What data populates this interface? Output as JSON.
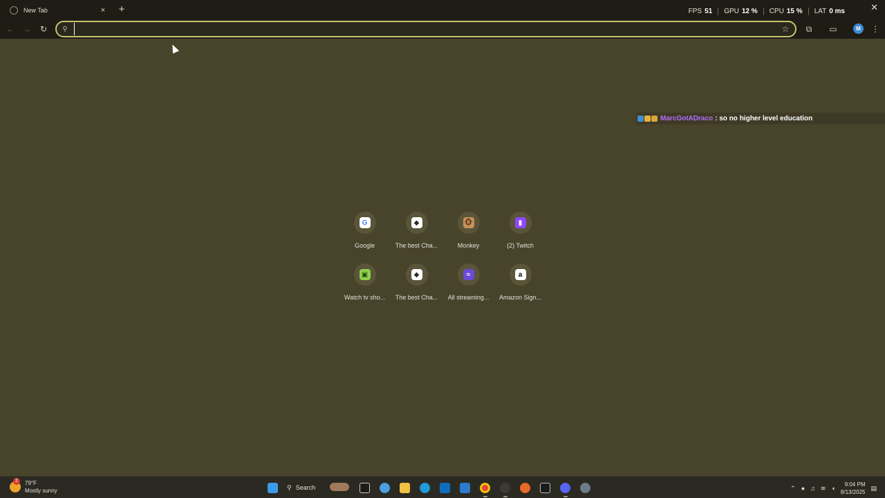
{
  "browser": {
    "tab_title": "New Tab",
    "tab_close": "×",
    "new_tab": "+",
    "window_close": "✕"
  },
  "overlay_stats": [
    {
      "label": "FPS",
      "value": "51"
    },
    {
      "label": "GPU",
      "value": "12 %"
    },
    {
      "label": "CPU",
      "value": "15 %"
    },
    {
      "label": "LAT",
      "value": "0 ms"
    }
  ],
  "toolbar": {
    "omnibox_value": "",
    "avatar_letter": "M"
  },
  "chat": {
    "username": "MarcGotADraco",
    "message": ": so no higher level education"
  },
  "shortcuts": [
    {
      "label": "Google",
      "icon": "google-icon",
      "glyph": "G",
      "color": "#ffffff",
      "text": "#4285f4"
    },
    {
      "label": "The best Cha...",
      "icon": "chess-icon",
      "glyph": "◆",
      "color": "#ffffff",
      "text": "#2b2a22"
    },
    {
      "label": "Monkey",
      "icon": "monkey-icon",
      "glyph": "🐵",
      "color": "#c8905a",
      "text": "#3a2612"
    },
    {
      "label": "(2) Twitch",
      "icon": "twitch-icon",
      "glyph": "▮",
      "color": "#9146ff",
      "text": "#ffffff"
    },
    {
      "label": "Watch tv sho...",
      "icon": "tv-icon",
      "glyph": "▣",
      "color": "#8fd14a",
      "text": "#2a4a10"
    },
    {
      "label": "The best Cha...",
      "icon": "chess-icon",
      "glyph": "◆",
      "color": "#ffffff",
      "text": "#2b2a22"
    },
    {
      "label": "All streaming...",
      "icon": "streaming-icon",
      "glyph": "≈",
      "color": "#6a4bd6",
      "text": "#ffffff"
    },
    {
      "label": "Amazon Sign...",
      "icon": "amazon-icon",
      "glyph": "a",
      "color": "#ffffff",
      "text": "#000000"
    }
  ],
  "taskbar": {
    "weather_badge": "2",
    "temperature": "79°F",
    "condition": "Mostly sunny",
    "search_label": "Search",
    "time": "9:04 PM",
    "date": "8/13/2025"
  },
  "colors": {
    "background": "#48432b",
    "accent": "#c9c56e"
  }
}
